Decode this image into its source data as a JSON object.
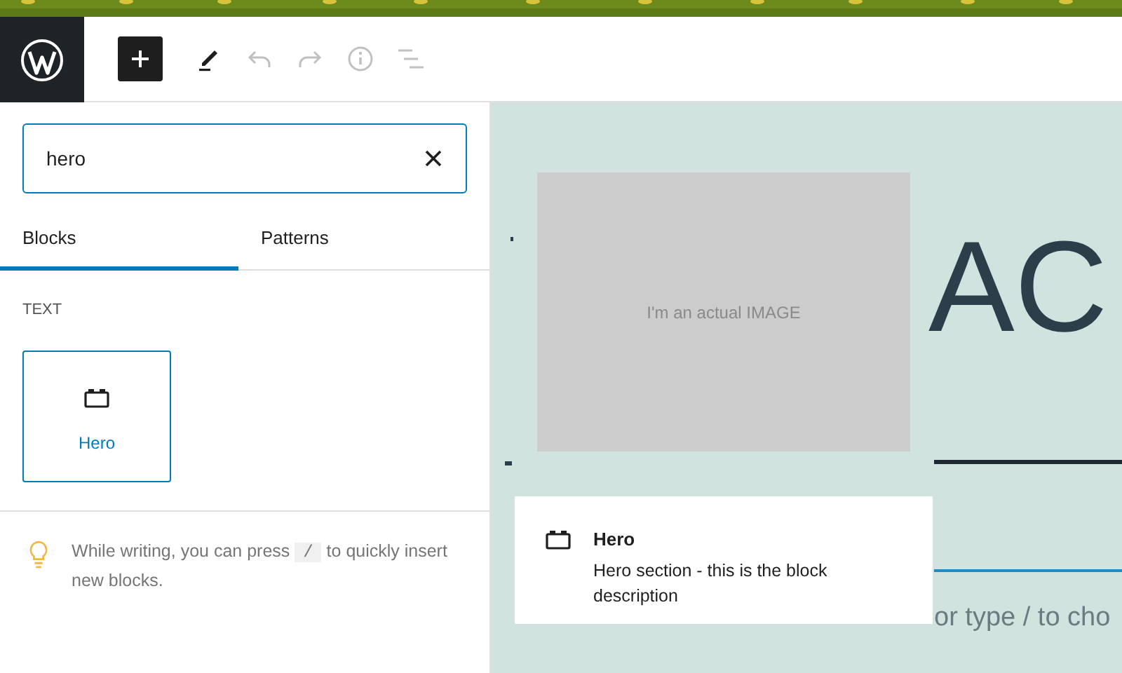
{
  "toolbar": {
    "buttons": [
      {
        "kind": "add",
        "disabled": false
      },
      {
        "kind": "edit",
        "disabled": false
      },
      {
        "kind": "undo",
        "disabled": true
      },
      {
        "kind": "redo",
        "disabled": true
      },
      {
        "kind": "info",
        "disabled": true
      },
      {
        "kind": "outline",
        "disabled": true
      }
    ]
  },
  "inserter": {
    "search": {
      "value": "hero"
    },
    "tabs": [
      {
        "label": "Blocks",
        "selected": true
      },
      {
        "label": "Patterns",
        "selected": false
      }
    ],
    "category": "TEXT",
    "blocks": [
      {
        "label": "Hero",
        "selected": true
      }
    ],
    "tip": {
      "before": "While writing, you can press",
      "key": "/",
      "after": "to quickly insert new blocks."
    }
  },
  "canvas": {
    "image_placeholder": "I'm an actual IMAGE",
    "heading": "AC",
    "paragraph_placeholder": "or type / to cho"
  },
  "preview": {
    "title": "Hero",
    "description": "Hero section - this is the block description"
  }
}
